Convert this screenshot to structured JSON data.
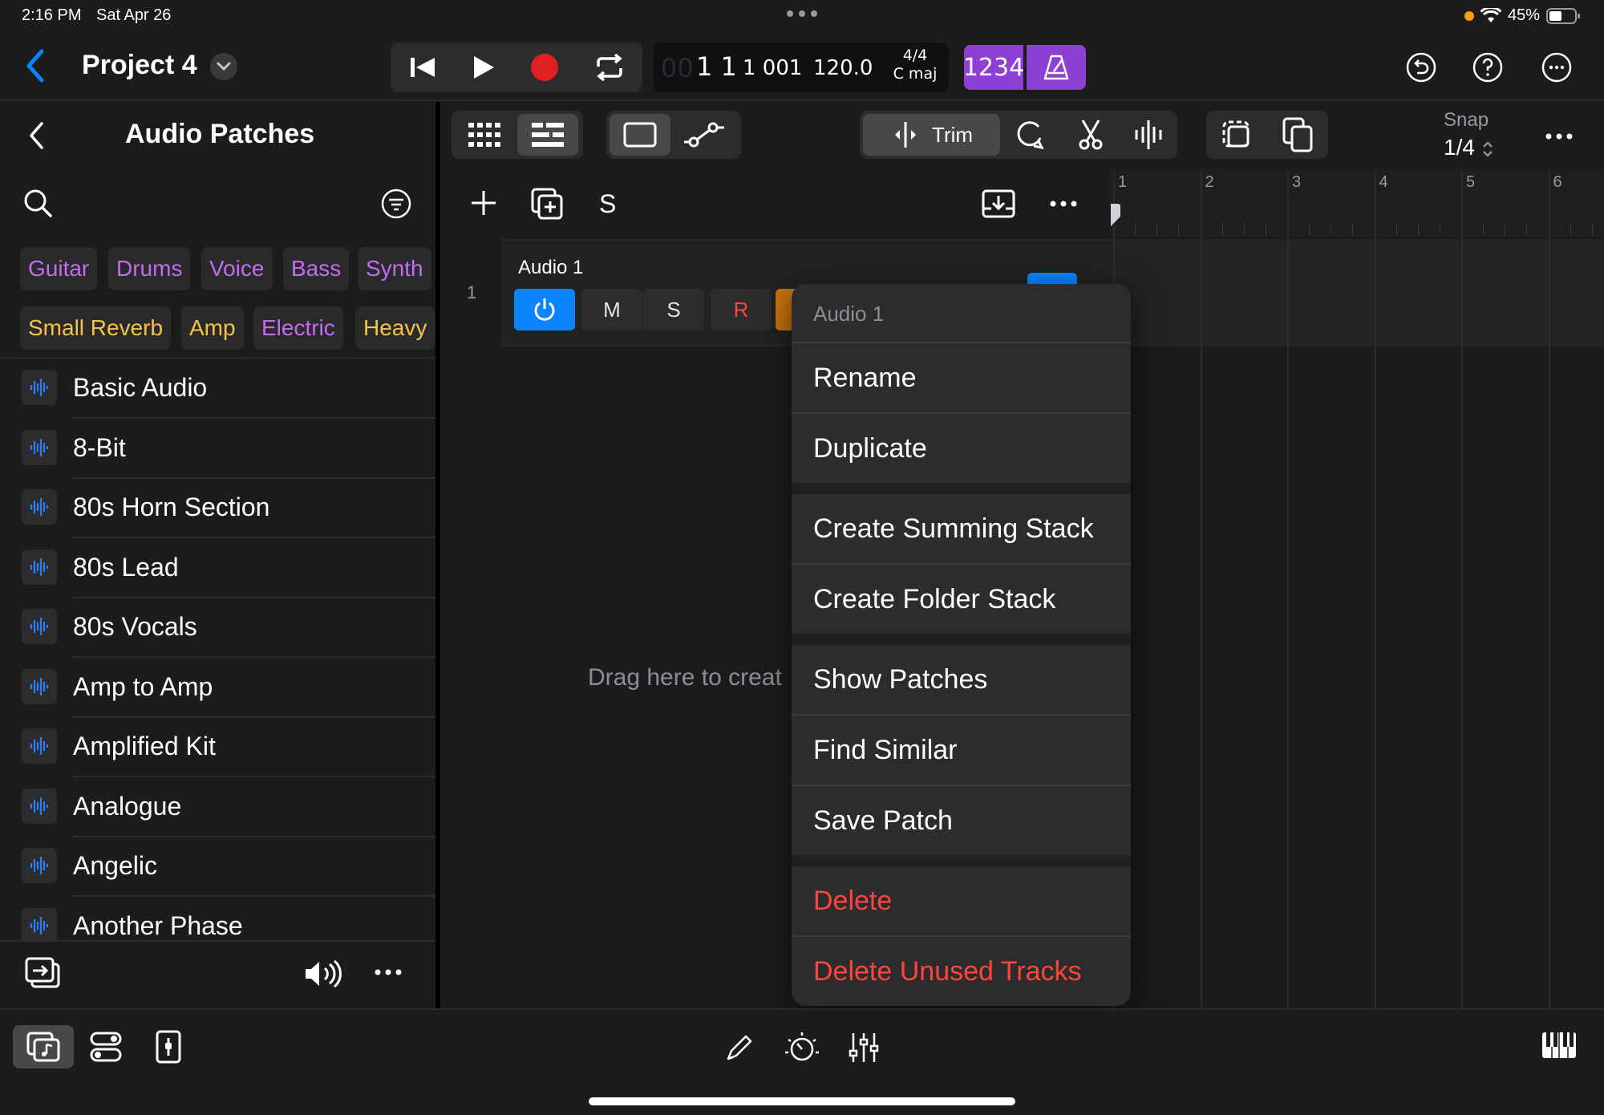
{
  "status": {
    "time": "2:16 PM",
    "date": "Sat Apr 26",
    "battery": "45%"
  },
  "header": {
    "project_title": "Project 4"
  },
  "lcd": {
    "ghost_digits": "00",
    "bar_beat": "1 1",
    "division_tick": "1 001",
    "tempo": "120.0",
    "time_signature": "4/4",
    "key": "C maj"
  },
  "count_in": "1234",
  "browser": {
    "title": "Audio Patches",
    "tags_row1": [
      "Guitar",
      "Drums",
      "Voice",
      "Bass",
      "Synth"
    ],
    "tags_row2": [
      "Small Reverb",
      "Amp",
      "Electric",
      "Heavy"
    ],
    "patches": [
      "Basic Audio",
      "8-Bit",
      "80s Horn Section",
      "80s Lead",
      "80s Vocals",
      "Amp to Amp",
      "Amplified Kit",
      "Analogue",
      "Angelic",
      "Another Phase"
    ]
  },
  "toolbar": {
    "trim_label": "Trim",
    "snap_label": "Snap",
    "snap_value": "1/4"
  },
  "tracks_header": {
    "solo_label": "S"
  },
  "track": {
    "number": "1",
    "name": "Audio 1",
    "mute": "M",
    "solo": "S",
    "record": "R"
  },
  "drag_hint": "Drag here to creat",
  "ruler": {
    "bars": [
      "1",
      "2",
      "3",
      "4",
      "5",
      "6"
    ]
  },
  "context_menu": {
    "header": "Audio 1",
    "rename": "Rename",
    "duplicate": "Duplicate",
    "create_summing_stack": "Create Summing Stack",
    "create_folder_stack": "Create Folder Stack",
    "show_patches": "Show Patches",
    "find_similar": "Find Similar",
    "save_patch": "Save Patch",
    "delete": "Delete",
    "delete_unused_tracks": "Delete Unused Tracks"
  },
  "colors": {
    "accent_blue": "#0a84ff",
    "record_red": "#e02020",
    "purple": "#8e3fd4",
    "tag_purple": "#c56bf2",
    "tag_yellow": "#f5c542",
    "danger": "#ff453a"
  }
}
